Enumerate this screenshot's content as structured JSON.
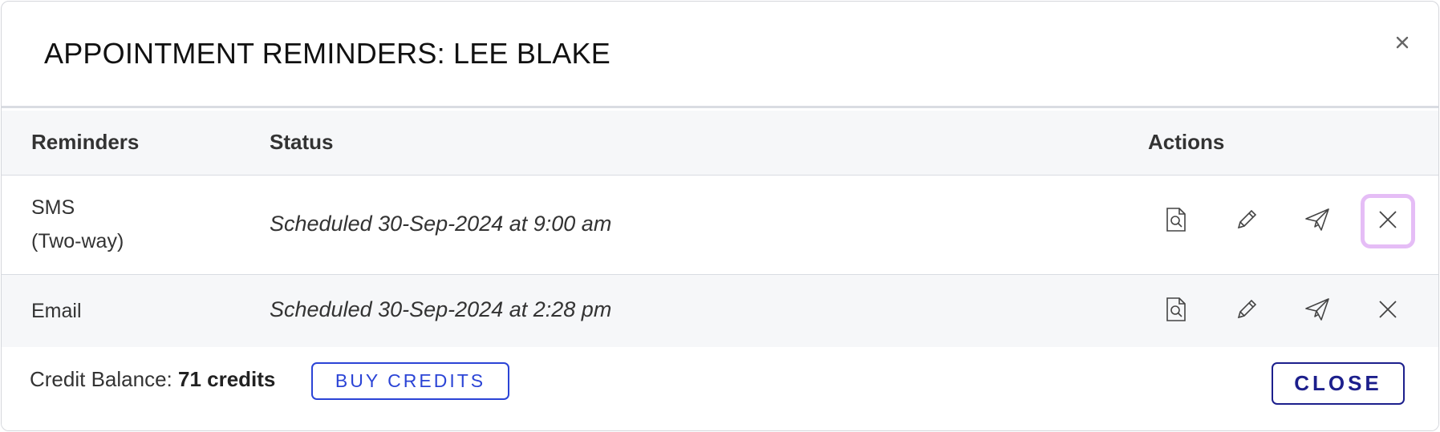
{
  "modal": {
    "title": "APPOINTMENT REMINDERS: LEE BLAKE",
    "close_icon": "close-icon"
  },
  "table": {
    "headers": {
      "reminders": "Reminders",
      "status": "Status",
      "actions": "Actions"
    },
    "rows": [
      {
        "name_line1": "SMS",
        "name_line2": "(Two-way)",
        "status": "Scheduled 30-Sep-2024 at 9:00 am",
        "actions": [
          "preview-icon",
          "edit-icon",
          "send-icon",
          "delete-icon"
        ]
      },
      {
        "name_line1": "Email",
        "status": "Scheduled 30-Sep-2024 at 2:28 pm",
        "actions": [
          "preview-icon",
          "edit-icon",
          "send-icon",
          "delete-icon"
        ]
      }
    ]
  },
  "footer": {
    "credit_label": "Credit Balance:",
    "credit_value": "71 credits",
    "buy_label": "BUY CREDITS",
    "close_label": "CLOSE"
  },
  "colors": {
    "accent_blue": "#2b44d6",
    "close_navy": "#1c1f8c",
    "focus_ring": "#e5bdf6",
    "header_bg": "#f6f7f9"
  }
}
